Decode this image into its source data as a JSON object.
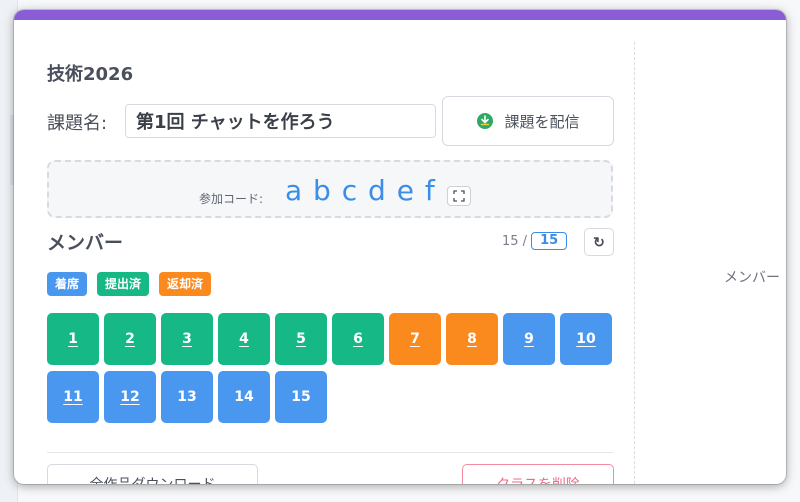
{
  "class": {
    "title": "技術2026"
  },
  "assignment": {
    "label": "課題名:",
    "value": "第1回 チャットを作ろう",
    "distribute_label": "課題を配信",
    "distribute_icon": "download-icon"
  },
  "join_code": {
    "label": "参加コード:",
    "value": "a b c d e f",
    "expand_icon": "expand-icon"
  },
  "members": {
    "title": "メンバー",
    "count_current": "15 /",
    "count_total": "15",
    "refresh_icon": "↻",
    "legend": [
      {
        "label": "着席",
        "color": "#4a97f0"
      },
      {
        "label": "提出済",
        "color": "#16b985"
      },
      {
        "label": "返却済",
        "color": "#fa8a1d"
      }
    ],
    "list": [
      {
        "number": "1",
        "status": "submitted"
      },
      {
        "number": "2",
        "status": "submitted"
      },
      {
        "number": "3",
        "status": "submitted"
      },
      {
        "number": "4",
        "status": "submitted"
      },
      {
        "number": "5",
        "status": "submitted"
      },
      {
        "number": "6",
        "status": "submitted"
      },
      {
        "number": "7",
        "status": "returned"
      },
      {
        "number": "8",
        "status": "returned"
      },
      {
        "number": "9",
        "status": "seated"
      },
      {
        "number": "10",
        "status": "seated"
      },
      {
        "number": "11",
        "status": "seated"
      },
      {
        "number": "12",
        "status": "seated"
      },
      {
        "number": "13",
        "status": "seated"
      },
      {
        "number": "14",
        "status": "seated"
      },
      {
        "number": "15",
        "status": "seated"
      }
    ]
  },
  "actions": {
    "download_all_label": "全作品ダウンロード",
    "delete_class_label": "クラスを削除"
  },
  "right_pane": {
    "label": "メンバー"
  },
  "colors": {
    "accent_bar": "#8a5cd6",
    "seated": "#4a97f0",
    "submitted": "#16b985",
    "returned": "#fa8a1d",
    "code_text": "#3a8ee8",
    "danger": "#ef6a84"
  }
}
